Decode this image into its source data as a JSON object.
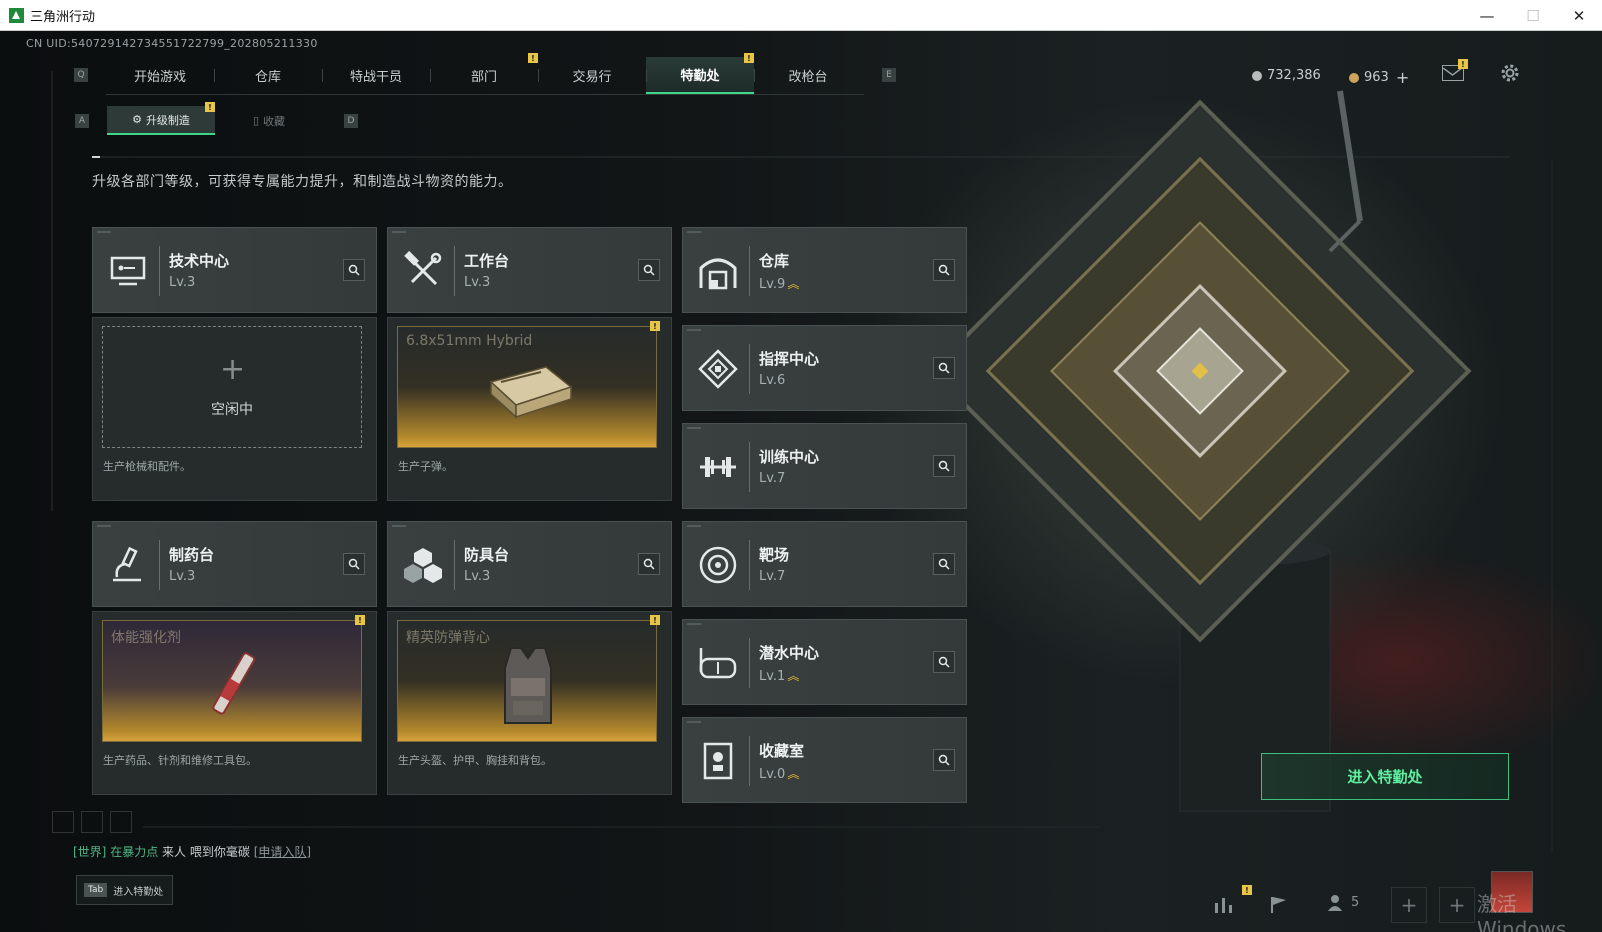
{
  "window": {
    "title": "三角洲行动",
    "minimize": "—",
    "maximize": "☐",
    "close": "✕"
  },
  "uid": "CN UID:540729142734551722799_202805211330",
  "hotkeys": {
    "prev_tab": "Q",
    "next_tab": "E",
    "prev_sub": "A",
    "next_sub": "D"
  },
  "main_tabs": [
    "开始游戏",
    "仓库",
    "特战干员",
    "部门",
    "交易行",
    "特勤处",
    "改枪台"
  ],
  "active_tab": "特勤处",
  "alert_mark": "!",
  "currency": {
    "coins": "732,386",
    "gems": "963",
    "add": "+"
  },
  "sub_tabs": [
    {
      "label": "升级制造",
      "icon": "⚙"
    },
    {
      "label": "收藏",
      "icon": "▯"
    }
  ],
  "description": "升级各部门等级，可获得专属能力提升，和制造战斗物资的能力。",
  "departments": {
    "tech": {
      "name": "技术中心",
      "level": "Lv.3",
      "icon": "tech-center-icon"
    },
    "workbench": {
      "name": "工作台",
      "level": "Lv.3",
      "icon": "workbench-icon"
    },
    "warehouse": {
      "name": "仓库",
      "level": "Lv.9",
      "icon": "warehouse-icon"
    },
    "command": {
      "name": "指挥中心",
      "level": "Lv.6",
      "icon": "command-center-icon"
    },
    "training": {
      "name": "训练中心",
      "level": "Lv.7",
      "icon": "training-center-icon"
    },
    "pharmacy": {
      "name": "制药台",
      "level": "Lv.3",
      "icon": "pharmacy-icon"
    },
    "armor": {
      "name": "防具台",
      "level": "Lv.3",
      "icon": "armor-bench-icon"
    },
    "range": {
      "name": "靶场",
      "level": "Lv.7",
      "icon": "shooting-range-icon"
    },
    "diving": {
      "name": "潜水中心",
      "level": "Lv.1",
      "icon": "diving-center-icon"
    },
    "collection": {
      "name": "收藏室",
      "level": "Lv.0",
      "icon": "collection-room-icon"
    }
  },
  "upgrade_chevron": "︽",
  "production": {
    "tech": {
      "status": "空闲中",
      "plus": "+",
      "footer": "生产枪械和配件。"
    },
    "workbench": {
      "item": "6.8x51mm Hybrid",
      "footer": "生产子弹。"
    },
    "pharmacy": {
      "item": "体能强化剂",
      "footer": "生产药品、针剂和维修工具包。"
    },
    "armor": {
      "item": "精英防弹背心",
      "footer": "生产头盔、护甲、胸挂和背包。"
    }
  },
  "enter_button": "进入特勤处",
  "chat": {
    "channel": "[世界]",
    "player": "在暴力点",
    "text": "来人  喂到你毫碳",
    "action": "[申请入队]"
  },
  "tab_hint": {
    "key": "Tab",
    "label": "进入特勤处"
  },
  "squad_count": "5",
  "watermark": "激活 Windows",
  "colors": {
    "accent": "#3fd68c",
    "alert": "#e8c547",
    "upgrade": "#e6b83a"
  }
}
